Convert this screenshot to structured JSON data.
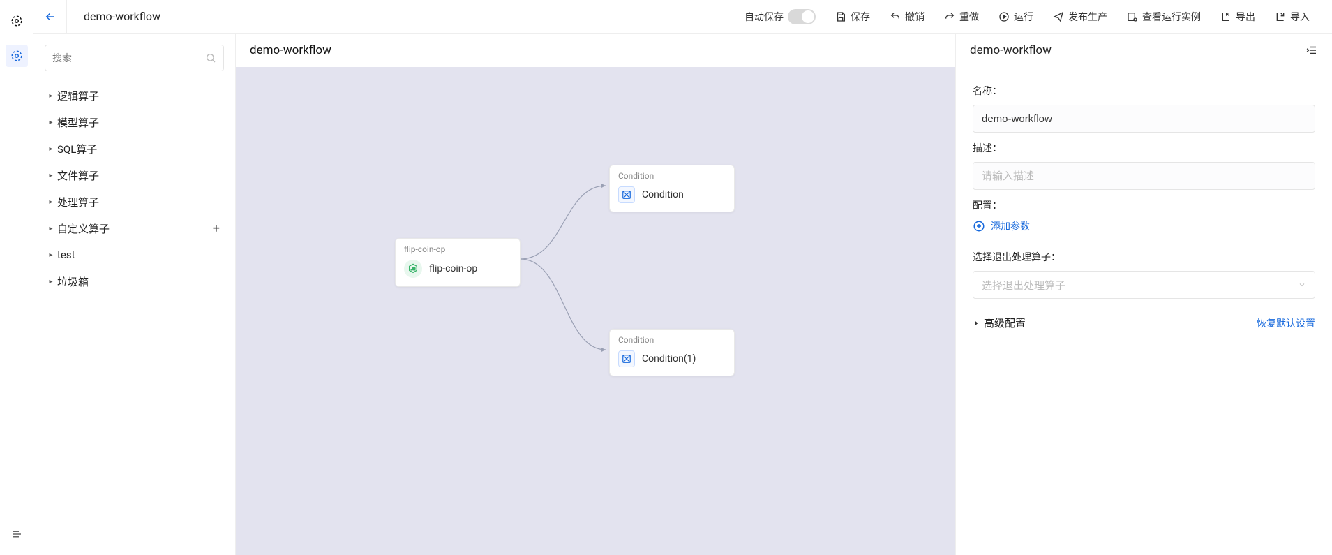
{
  "header": {
    "workflow_name": "demo-workflow",
    "autosave_label": "自动保存",
    "save": "保存",
    "undo": "撤销",
    "redo": "重做",
    "run": "运行",
    "publish": "发布生产",
    "instances": "查看运行实例",
    "export": "导出",
    "import": "导入"
  },
  "sidebar": {
    "search_placeholder": "搜索",
    "items": [
      {
        "label": "逻辑算子",
        "add": false
      },
      {
        "label": "模型算子",
        "add": false
      },
      {
        "label": "SQL算子",
        "add": false
      },
      {
        "label": "文件算子",
        "add": false
      },
      {
        "label": "处理算子",
        "add": false
      },
      {
        "label": "自定义算子",
        "add": true
      },
      {
        "label": "test",
        "add": false
      },
      {
        "label": "垃圾箱",
        "add": false
      }
    ]
  },
  "canvas": {
    "title": "demo-workflow",
    "nodes": {
      "flip": {
        "header": "flip-coin-op",
        "label": "flip-coin-op"
      },
      "cond1": {
        "header": "Condition",
        "label": "Condition"
      },
      "cond2": {
        "header": "Condition",
        "label": "Condition(1)"
      }
    }
  },
  "inspector": {
    "title": "demo-workflow",
    "name_label": "名称：",
    "name_value": "demo-workflow",
    "desc_label": "描述：",
    "desc_placeholder": "请输入描述",
    "config_label": "配置：",
    "add_param": "添加参数",
    "exit_label": "选择退出处理算子：",
    "exit_placeholder": "选择退出处理算子",
    "advanced": "高级配置",
    "restore": "恢复默认设置"
  }
}
